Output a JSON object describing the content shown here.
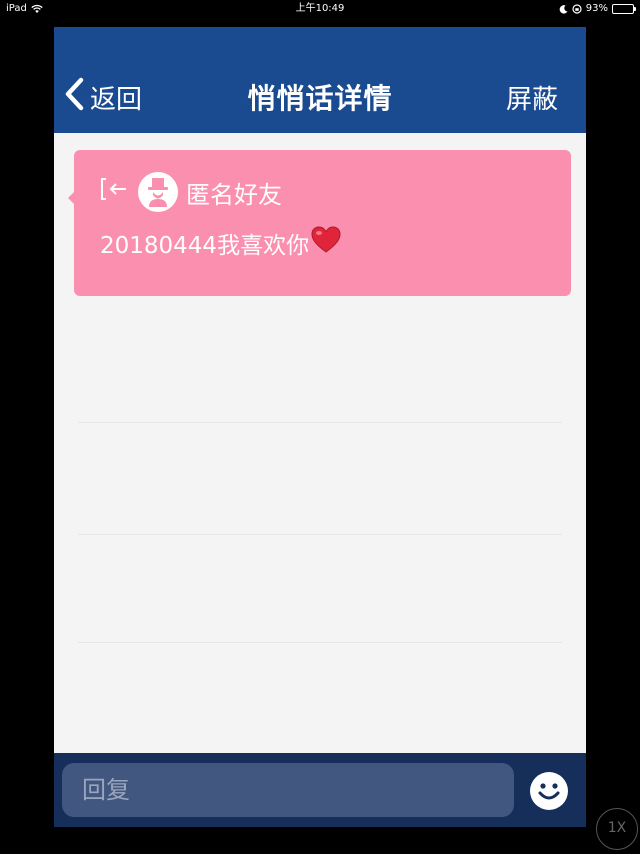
{
  "statusbar": {
    "device": "iPad",
    "time": "上午10:49",
    "battery": "93%",
    "battery_level": 0.93
  },
  "navbar": {
    "back_label": "返回",
    "title": "悄悄话详情",
    "block_label": "屏蔽",
    "bg_color": "#1a4a8f"
  },
  "message": {
    "sender": "匿名好友",
    "text": "20180444我喜欢你",
    "emoji": "heart-icon",
    "bg_color": "#fb8faf"
  },
  "reply": {
    "placeholder": "回复"
  },
  "zoom": {
    "label": "1X"
  }
}
